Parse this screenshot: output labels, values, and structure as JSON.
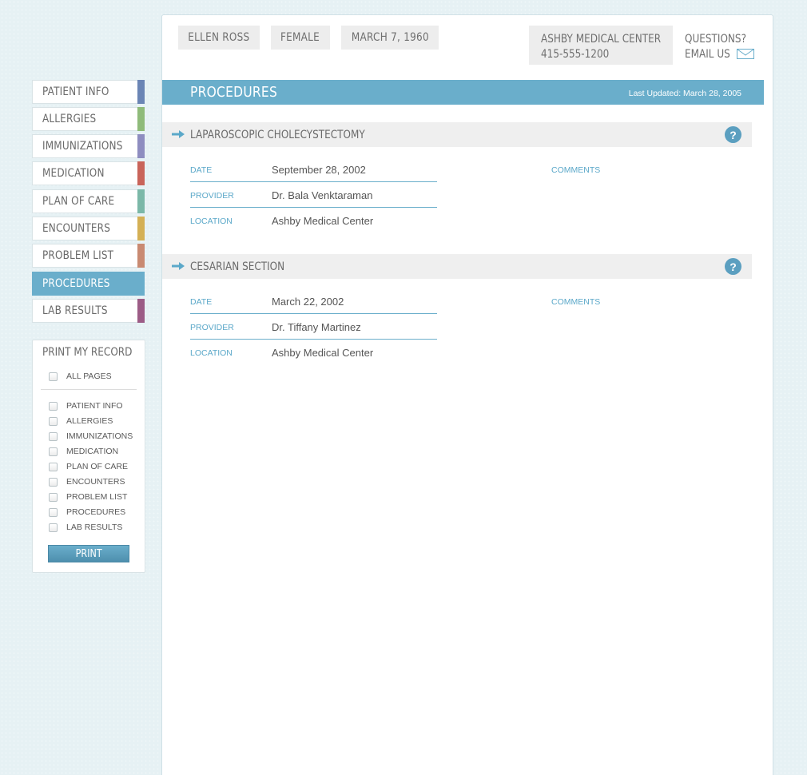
{
  "patient": {
    "name": "ELLEN ROSS",
    "sex": "FEMALE",
    "dob": "MARCH 7, 1960"
  },
  "provider_contact": {
    "center": "ASHBY MEDICAL CENTER",
    "phone": "415-555-1200"
  },
  "help": {
    "questions": "QUESTIONS?",
    "email": "EMAIL US"
  },
  "nav": {
    "items": [
      {
        "label": "PATIENT INFO",
        "color": "#6b85b5"
      },
      {
        "label": "ALLERGIES",
        "color": "#8fbb7a"
      },
      {
        "label": "IMMUNIZATIONS",
        "color": "#8e8dc0"
      },
      {
        "label": "MEDICATION",
        "color": "#c9645a"
      },
      {
        "label": "PLAN OF CARE",
        "color": "#7bb8a8"
      },
      {
        "label": "ENCOUNTERS",
        "color": "#d4b055"
      },
      {
        "label": "PROBLEM LIST",
        "color": "#c98a72"
      },
      {
        "label": "PROCEDURES",
        "color": "#6aaecb"
      },
      {
        "label": "LAB RESULTS",
        "color": "#9c5c86"
      }
    ],
    "active": "PROCEDURES"
  },
  "print": {
    "title": "PRINT MY RECORD",
    "all_pages": "ALL PAGES",
    "options": [
      "PATIENT INFO",
      "ALLERGIES",
      "IMMUNIZATIONS",
      "MEDICATION",
      "PLAN OF CARE",
      "ENCOUNTERS",
      "PROBLEM LIST",
      "PROCEDURES",
      "LAB RESULTS"
    ],
    "button": "PRINT"
  },
  "page": {
    "title": "PROCEDURES",
    "last_updated": "Last Updated: March 28, 2005"
  },
  "labels": {
    "date": "DATE",
    "provider": "PROVIDER",
    "location": "LOCATION",
    "comments": "COMMENTS",
    "help_glyph": "?"
  },
  "procedures": [
    {
      "name": "LAPAROSCOPIC CHOLECYSTECTOMY",
      "date": "September 28, 2002",
      "provider": "Dr. Bala Venktaraman",
      "location": "Ashby Medical Center"
    },
    {
      "name": "CESARIAN SECTION",
      "date": "March 22, 2002",
      "provider": "Dr. Tiffany Martinez",
      "location": "Ashby Medical Center"
    }
  ],
  "colors": {
    "accent": "#6aaecb",
    "background": "#e6f1f4"
  }
}
